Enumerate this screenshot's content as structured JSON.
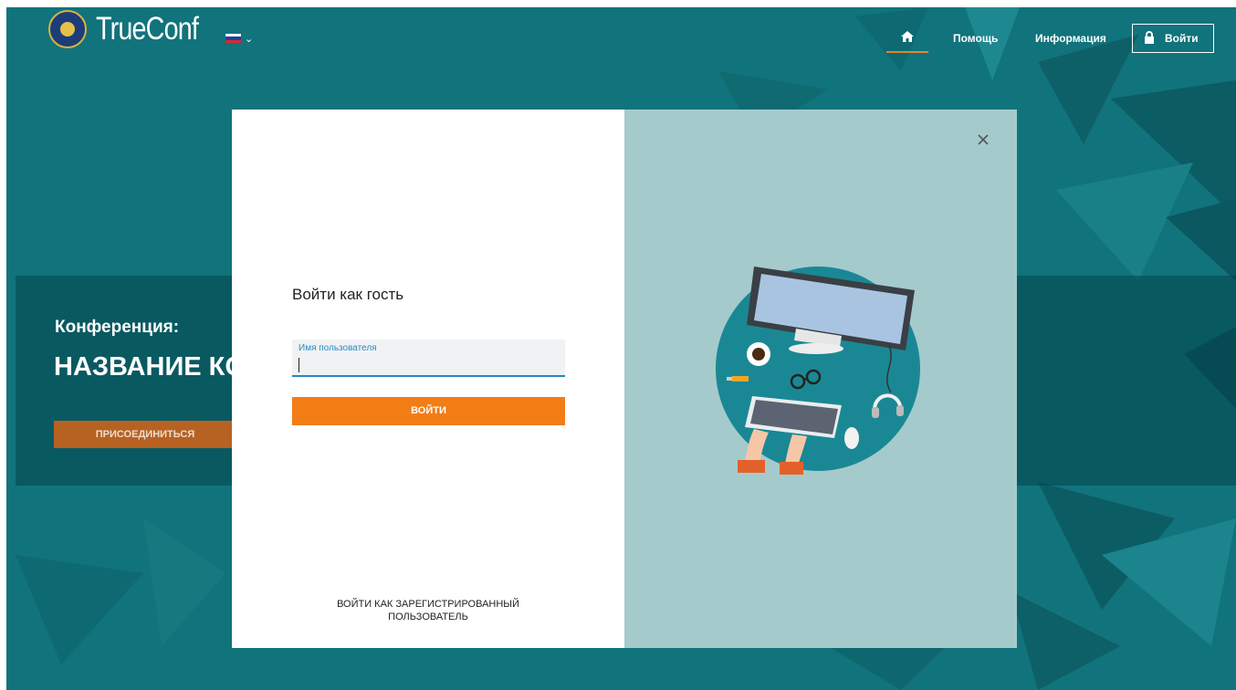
{
  "header": {
    "brand": "TrueConf",
    "logo_icon": "emblem-icon",
    "language": {
      "icon": "flag-ru-icon",
      "colors": [
        "#ffffff",
        "#1f3fa8",
        "#d62b2b"
      ]
    },
    "home_icon": "home-icon",
    "nav": [
      "Помощь",
      "Информация"
    ],
    "login_label": "Войти",
    "login_icon": "lock-icon"
  },
  "page": {
    "conference_label": "Конференция:",
    "conference_name": "НАЗВАНИЕ КОНФЕРЕНЦИИ",
    "join_label": "ПРИСОЕДИНИТЬСЯ"
  },
  "modal": {
    "title": "Войти как гость",
    "username_label": "Имя пользователя",
    "username_value": "",
    "submit_label": "ВОЙТИ",
    "register_link": "ВОЙТИ КАК ЗАРЕГИСТРИРОВАННЫЙ ПОЛЬЗОВАТЕЛЬ",
    "close_icon": "close-icon",
    "illustration_icon": "workspace-illustration-icon"
  },
  "colors": {
    "background": "#11737b",
    "accent": "#f27d15",
    "join_button": "#b76222",
    "field_accent": "#2088c4",
    "illustration_bg": "#a5cacc"
  }
}
